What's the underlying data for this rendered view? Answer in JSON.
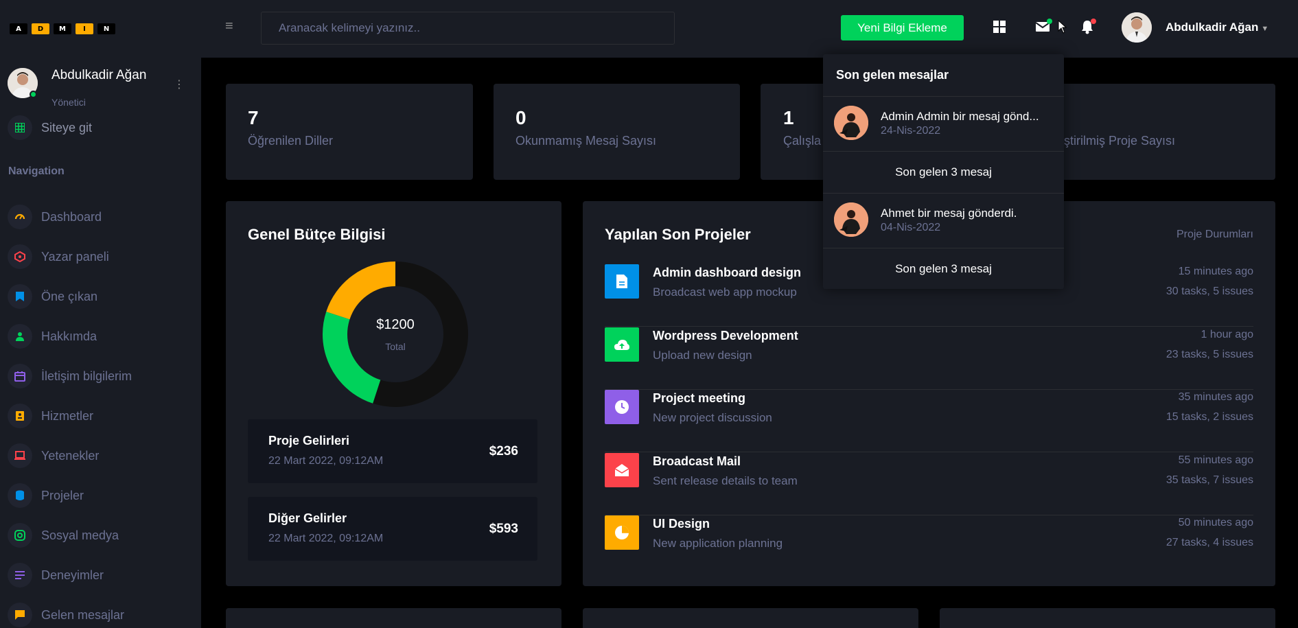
{
  "brand": {
    "logo_letters": [
      "A",
      "D",
      "M",
      "I",
      "N"
    ]
  },
  "topbar": {
    "search_placeholder": "Aranacak kelimeyi yazınız..",
    "add_button": "Yeni Bilgi Ekleme",
    "user_name": "Abdulkadir Ağan"
  },
  "sidebar": {
    "profile_name": "Abdulkadir Ağan",
    "profile_role": "Yönetici",
    "site_link": "Siteye git",
    "nav_heading": "Navigation",
    "items": [
      {
        "label": "Dashboard",
        "icon": "speedometer-icon",
        "color": "#ffab00"
      },
      {
        "label": "Yazar paneli",
        "icon": "playlist-icon",
        "color": "#fc424a"
      },
      {
        "label": "Öne çıkan",
        "icon": "bookmark-icon",
        "color": "#0090e7"
      },
      {
        "label": "Hakkımda",
        "icon": "person-icon",
        "color": "#00d25b"
      },
      {
        "label": "İletişim bilgilerim",
        "icon": "calendar-icon",
        "color": "#8f5fe8"
      },
      {
        "label": "Hizmetler",
        "icon": "badge-icon",
        "color": "#ffab00"
      },
      {
        "label": "Yetenekler",
        "icon": "laptop-icon",
        "color": "#fc424a"
      },
      {
        "label": "Projeler",
        "icon": "database-icon",
        "color": "#0090e7"
      },
      {
        "label": "Sosyal medya",
        "icon": "instagram-icon",
        "color": "#00d25b"
      },
      {
        "label": "Deneyimler",
        "icon": "list-icon",
        "color": "#8f5fe8"
      },
      {
        "label": "Gelen mesajlar",
        "icon": "message-icon",
        "color": "#ffab00"
      }
    ]
  },
  "stats": [
    {
      "value": "7",
      "label": "Öğrenilen Diller"
    },
    {
      "value": "0",
      "label": "Okunmamış Mesaj Sayısı"
    },
    {
      "value": "1",
      "label": "Çalışla"
    },
    {
      "value": "",
      "label": "eliştirilmiş Proje Sayısı"
    }
  ],
  "budget": {
    "title": "Genel Bütçe Bilgisi",
    "center_amount": "$1200",
    "center_label": "Total",
    "items": [
      {
        "title": "Proje Gelirleri",
        "date": "22 Mart 2022, 09:12AM",
        "value": "$236"
      },
      {
        "title": "Diğer Gelirler",
        "date": "22 Mart 2022, 09:12AM",
        "value": "$593"
      }
    ]
  },
  "chart_data": {
    "type": "pie",
    "title": "",
    "categories": [
      "Dark segment",
      "Green segment",
      "Yellow segment"
    ],
    "values": [
      55,
      25,
      20
    ],
    "colors": [
      "#111111",
      "#00d25b",
      "#ffab00"
    ]
  },
  "projects": {
    "title": "Yapılan Son Projeler",
    "status_link": "Proje Durumları",
    "rows": [
      {
        "title": "Admin dashboard design",
        "desc": "Broadcast web app mockup",
        "time": "15 minutes ago",
        "stats": "30 tasks, 5 issues",
        "color": "#0090e7",
        "icon": "file-icon"
      },
      {
        "title": "Wordpress Development",
        "desc": "Upload new design",
        "time": "1 hour ago",
        "stats": "23 tasks, 5 issues",
        "color": "#00d25b",
        "icon": "cloud-upload-icon"
      },
      {
        "title": "Project meeting",
        "desc": "New project discussion",
        "time": "35 minutes ago",
        "stats": "15 tasks, 2 issues",
        "color": "#8f5fe8",
        "icon": "clock-icon"
      },
      {
        "title": "Broadcast Mail",
        "desc": "Sent release details to team",
        "time": "55 minutes ago",
        "stats": "35 tasks, 7 issues",
        "color": "#fc424a",
        "icon": "mail-open-icon"
      },
      {
        "title": "UI Design",
        "desc": "New application planning",
        "time": "50 minutes ago",
        "stats": "27 tasks, 4 issues",
        "color": "#ffab00",
        "icon": "chart-pie-icon"
      }
    ]
  },
  "messages_dropdown": {
    "title": "Son gelen mesajlar",
    "items": [
      {
        "text": "Admin Admin bir mesaj gönd...",
        "date": "24-Nis-2022"
      },
      {
        "text": "Ahmet bir mesaj gönderdi.",
        "date": "04-Nis-2022"
      }
    ],
    "footer": "Son gelen 3 mesaj"
  }
}
